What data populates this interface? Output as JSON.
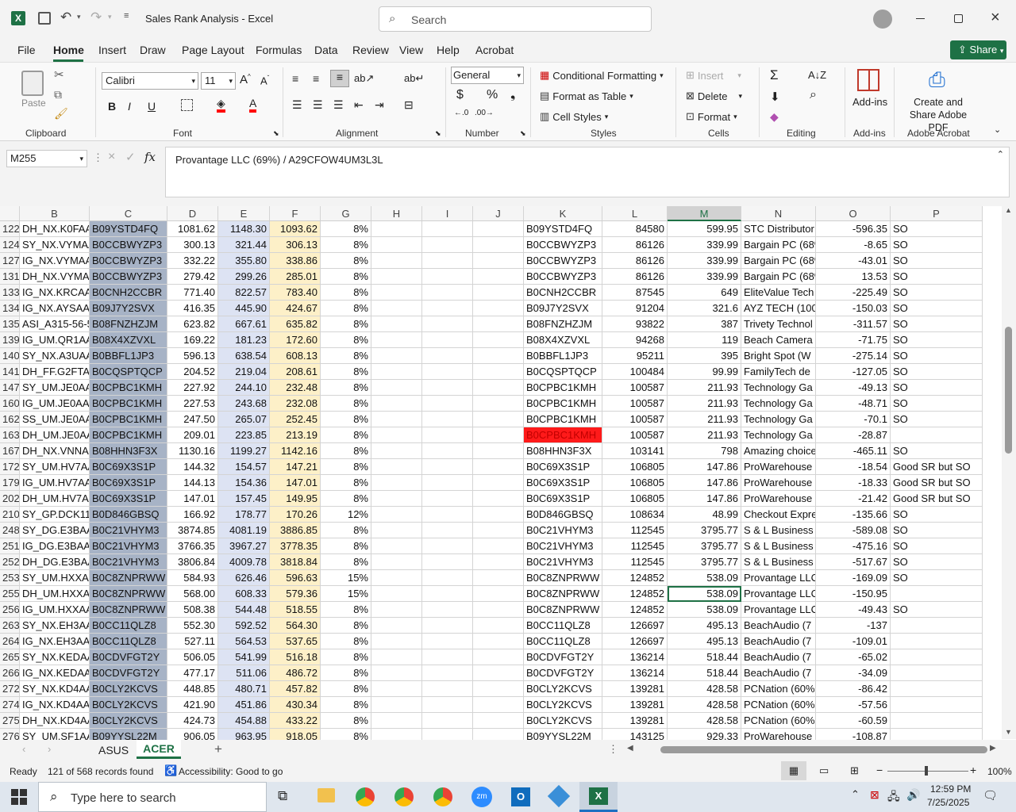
{
  "app": {
    "title": "Sales Rank Analysis  -  Excel",
    "search_placeholder": "Search"
  },
  "menu": [
    "File",
    "Home",
    "Insert",
    "Draw",
    "Page Layout",
    "Formulas",
    "Data",
    "Review",
    "View",
    "Help",
    "Acrobat"
  ],
  "share_label": "Share",
  "ribbon": {
    "clipboard": {
      "paste": "Paste",
      "label": "Clipboard"
    },
    "font": {
      "name": "Calibri",
      "size": "11",
      "label": "Font"
    },
    "alignment": {
      "label": "Alignment"
    },
    "number": {
      "format": "General",
      "label": "Number"
    },
    "styles": {
      "cond": "Conditional Formatting",
      "table": "Format as Table",
      "cell": "Cell Styles",
      "label": "Styles"
    },
    "cells": {
      "insert": "Insert",
      "delete": "Delete",
      "format": "Format",
      "label": "Cells"
    },
    "editing": {
      "label": "Editing"
    },
    "addins": {
      "btn": "Add-ins",
      "label": "Add-ins"
    },
    "acrobat": {
      "btn": "Create and Share Adobe PDF",
      "label": "Adobe Acrobat"
    }
  },
  "formula": {
    "namebox": "M255",
    "content": "Provantage LLC (69%) / A29CFOW4UM3L3L"
  },
  "columns": [
    "B",
    "C",
    "D",
    "E",
    "F",
    "G",
    "H",
    "I",
    "J",
    "K",
    "L",
    "M",
    "N",
    "O",
    "P"
  ],
  "rows": [
    [
      "122",
      "DH_NX.K0FAA",
      "B09YSTD4FQ",
      "1081.62",
      "1148.30",
      "1093.62",
      "8%",
      "B09YSTD4FQ",
      "84580",
      "599.95",
      "STC Distributor",
      "-596.35",
      "SO"
    ],
    [
      "124",
      "SY_NX.VYMAA",
      "B0CCBWYZP3",
      "300.13",
      "321.44",
      "306.13",
      "8%",
      "B0CCBWYZP3",
      "86126",
      "339.99",
      "Bargain PC (68%",
      "-8.65",
      "SO"
    ],
    [
      "127",
      "IG_NX.VYMAA",
      "B0CCBWYZP3",
      "332.22",
      "355.80",
      "338.86",
      "8%",
      "B0CCBWYZP3",
      "86126",
      "339.99",
      "Bargain PC (68%",
      "-43.01",
      "SO"
    ],
    [
      "131",
      "DH_NX.VYMAA",
      "B0CCBWYZP3",
      "279.42",
      "299.26",
      "285.01",
      "8%",
      "B0CCBWYZP3",
      "86126",
      "339.99",
      "Bargain PC (68%",
      "13.53",
      "SO"
    ],
    [
      "133",
      "IG_NX.KRCAA",
      "B0CNH2CCBR",
      "771.40",
      "822.57",
      "783.40",
      "8%",
      "B0CNH2CCBR",
      "87545",
      "649",
      "EliteValue Tech",
      "-225.49",
      "SO"
    ],
    [
      "134",
      "IG_NX.AYSAA",
      "B09J7Y2SVX",
      "416.35",
      "445.90",
      "424.67",
      "8%",
      "B09J7Y2SVX",
      "91204",
      "321.6",
      "AYZ TECH (100%",
      "-150.03",
      "SO"
    ],
    [
      "135",
      "ASI_A315-56-5",
      "B08FNZHZJM",
      "623.82",
      "667.61",
      "635.82",
      "8%",
      "B08FNZHZJM",
      "93822",
      "387",
      "Trivety Technol",
      "-311.57",
      "SO"
    ],
    [
      "139",
      "IG_UM.QR1AA",
      "B08X4XZVXL",
      "169.22",
      "181.23",
      "172.60",
      "8%",
      "B08X4XZVXL",
      "94268",
      "119",
      "Beach Camera (",
      "-71.75",
      "SO"
    ],
    [
      "140",
      "SY_NX.A3UAA",
      "B0BBFL1JP3",
      "596.13",
      "638.54",
      "608.13",
      "8%",
      "B0BBFL1JP3",
      "95211",
      "395",
      "Bright Spot (W",
      "-275.14",
      "SO"
    ],
    [
      "141",
      "DH_FF.G2FTA",
      "B0CQSPTQCP",
      "204.52",
      "219.04",
      "208.61",
      "8%",
      "B0CQSPTQCP",
      "100484",
      "99.99",
      "FamilyTech de",
      "-127.05",
      "SO"
    ],
    [
      "147",
      "SY_UM.JE0AA",
      "B0CPBC1KMH",
      "227.92",
      "244.10",
      "232.48",
      "8%",
      "B0CPBC1KMH",
      "100587",
      "211.93",
      "Technology Ga",
      "-49.13",
      "SO"
    ],
    [
      "160",
      "IG_UM.JE0AA",
      "B0CPBC1KMH",
      "227.53",
      "243.68",
      "232.08",
      "8%",
      "B0CPBC1KMH",
      "100587",
      "211.93",
      "Technology Ga",
      "-48.71",
      "SO"
    ],
    [
      "162",
      "SS_UM.JE0AA",
      "B0CPBC1KMH",
      "247.50",
      "265.07",
      "252.45",
      "8%",
      "B0CPBC1KMH",
      "100587",
      "211.93",
      "Technology Ga",
      "-70.1",
      "SO"
    ],
    [
      "163",
      "DH_UM.JE0AA",
      "B0CPBC1KMH",
      "209.01",
      "223.85",
      "213.19",
      "8%",
      "B0CPBC1KMH",
      "100587",
      "211.93",
      "Technology Ga",
      "-28.87",
      ""
    ],
    [
      "167",
      "DH_NX.VNNA",
      "B08HHN3F3X",
      "1130.16",
      "1199.27",
      "1142.16",
      "8%",
      "B08HHN3F3X",
      "103141",
      "798",
      "Amazing choice",
      "-465.11",
      "SO"
    ],
    [
      "172",
      "SY_UM.HV7AA",
      "B0C69X3S1P",
      "144.32",
      "154.57",
      "147.21",
      "8%",
      "B0C69X3S1P",
      "106805",
      "147.86",
      "ProWarehouse",
      "-18.54",
      "Good SR but SO"
    ],
    [
      "179",
      "IG_UM.HV7AA",
      "B0C69X3S1P",
      "144.13",
      "154.36",
      "147.01",
      "8%",
      "B0C69X3S1P",
      "106805",
      "147.86",
      "ProWarehouse",
      "-18.33",
      "Good SR but SO"
    ],
    [
      "202",
      "DH_UM.HV7AA",
      "B0C69X3S1P",
      "147.01",
      "157.45",
      "149.95",
      "8%",
      "B0C69X3S1P",
      "106805",
      "147.86",
      "ProWarehouse",
      "-21.42",
      "Good SR but SO"
    ],
    [
      "210",
      "SY_GP.DCK11",
      "B0D846GBSQ",
      "166.92",
      "178.77",
      "170.26",
      "12%",
      "B0D846GBSQ",
      "108634",
      "48.99",
      "Checkout Expre",
      "-135.66",
      "SO"
    ],
    [
      "248",
      "SY_DG.E3BAA",
      "B0C21VHYM3",
      "3874.85",
      "4081.19",
      "3886.85",
      "8%",
      "B0C21VHYM3",
      "112545",
      "3795.77",
      "S & L Business",
      "-589.08",
      "SO"
    ],
    [
      "251",
      "IG_DG.E3BAA",
      "B0C21VHYM3",
      "3766.35",
      "3967.27",
      "3778.35",
      "8%",
      "B0C21VHYM3",
      "112545",
      "3795.77",
      "S & L Business",
      "-475.16",
      "SO"
    ],
    [
      "252",
      "DH_DG.E3BAA",
      "B0C21VHYM3",
      "3806.84",
      "4009.78",
      "3818.84",
      "8%",
      "B0C21VHYM3",
      "112545",
      "3795.77",
      "S & L Business",
      "-517.67",
      "SO"
    ],
    [
      "253",
      "SY_UM.HXXAA",
      "B0C8ZNPRWW",
      "584.93",
      "626.46",
      "596.63",
      "15%",
      "B0C8ZNPRWW",
      "124852",
      "538.09",
      "Provantage LLC",
      "-169.09",
      "SO"
    ],
    [
      "255",
      "DH_UM.HXXAA",
      "B0C8ZNPRWW",
      "568.00",
      "608.33",
      "579.36",
      "15%",
      "B0C8ZNPRWW",
      "124852",
      "538.09",
      "Provantage LLC",
      "-150.95",
      ""
    ],
    [
      "256",
      "IG_UM.HXXAA",
      "B0C8ZNPRWW",
      "508.38",
      "544.48",
      "518.55",
      "8%",
      "B0C8ZNPRWW",
      "124852",
      "538.09",
      "Provantage LLC",
      "-49.43",
      "SO"
    ],
    [
      "263",
      "SY_NX.EH3AA",
      "B0CC11QLZ8",
      "552.30",
      "592.52",
      "564.30",
      "8%",
      "B0CC11QLZ8",
      "126697",
      "495.13",
      "BeachAudio (7",
      "-137",
      ""
    ],
    [
      "264",
      "IG_NX.EH3AA",
      "B0CC11QLZ8",
      "527.11",
      "564.53",
      "537.65",
      "8%",
      "B0CC11QLZ8",
      "126697",
      "495.13",
      "BeachAudio (7",
      "-109.01",
      ""
    ],
    [
      "265",
      "SY_NX.KEDAA",
      "B0CDVFGT2Y",
      "506.05",
      "541.99",
      "516.18",
      "8%",
      "B0CDVFGT2Y",
      "136214",
      "518.44",
      "BeachAudio (7",
      "-65.02",
      ""
    ],
    [
      "266",
      "IG_NX.KEDAA",
      "B0CDVFGT2Y",
      "477.17",
      "511.06",
      "486.72",
      "8%",
      "B0CDVFGT2Y",
      "136214",
      "518.44",
      "BeachAudio (7",
      "-34.09",
      ""
    ],
    [
      "272",
      "SY_NX.KD4AA",
      "B0CLY2KCVS",
      "448.85",
      "480.71",
      "457.82",
      "8%",
      "B0CLY2KCVS",
      "139281",
      "428.58",
      "PCNation (60%",
      "-86.42",
      ""
    ],
    [
      "274",
      "IG_NX.KD4AA",
      "B0CLY2KCVS",
      "421.90",
      "451.86",
      "430.34",
      "8%",
      "B0CLY2KCVS",
      "139281",
      "428.58",
      "PCNation (60%",
      "-57.56",
      ""
    ],
    [
      "275",
      "DH_NX.KD4AA",
      "B0CLY2KCVS",
      "424.73",
      "454.88",
      "433.22",
      "8%",
      "B0CLY2KCVS",
      "139281",
      "428.58",
      "PCNation (60%",
      "-60.59",
      ""
    ],
    [
      "276",
      "SY_UM.SF1AA",
      "B09YYSL22M",
      "906.05",
      "963.95",
      "918.05",
      "8%",
      "B09YYSL22M",
      "143125",
      "929.33",
      "ProWarehouse",
      "-108.87",
      ""
    ]
  ],
  "highlight": {
    "red_cell": "163",
    "selected_cell": "255"
  },
  "sheets": [
    "ASUS",
    "ACER"
  ],
  "status": {
    "ready": "Ready",
    "records": "121 of 568 records found",
    "accessibility": "Accessibility: Good to go",
    "zoom": "100%"
  },
  "taskbar": {
    "search": "Type here to search",
    "time": "12:59 PM",
    "date": "7/25/2025"
  },
  "colors": {
    "c_col": "#a7b3c6",
    "d_col": "#ffffff",
    "e_col": "#dde3f3",
    "f_col": "#fdf0c8",
    "red": "#ff1a1a",
    "excel_green": "#1e7145"
  }
}
